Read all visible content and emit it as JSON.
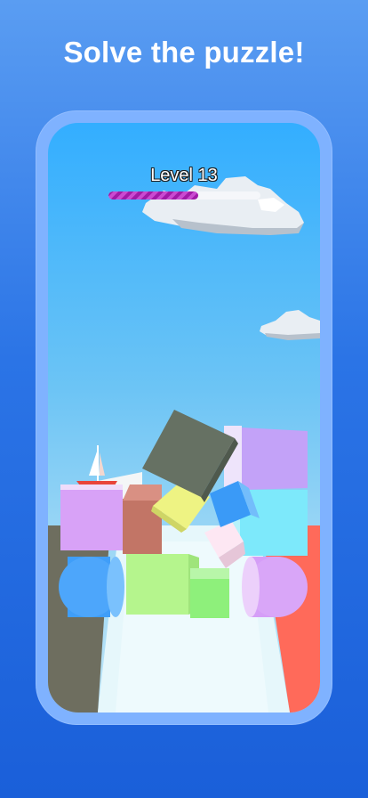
{
  "headline": "Solve the puzzle!",
  "game": {
    "level_label": "Level 13",
    "progress": 0.59
  },
  "colors": {
    "background": "#2b74e6",
    "phone_frame": "#7fb2ff",
    "sky": "#6cc4f5",
    "progress_fill": "#a11aa8"
  }
}
